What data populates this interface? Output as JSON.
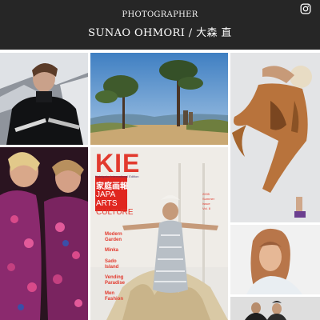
{
  "header": {
    "kicker": "PHOTOGRAPHER",
    "name": "SUNAO OHMORI / 大森 直",
    "background": "#262626"
  },
  "social": {
    "icon": "instagram-icon"
  },
  "gallery": {
    "tiles": [
      {
        "subject": "ski-portrait",
        "accent": "#ffffff"
      },
      {
        "subject": "landscape-pine-trees",
        "accent": "#4a88c4"
      },
      {
        "subject": "dancer-leopard-dress",
        "accent": "#b0743a"
      },
      {
        "subject": "fashion-models-floral-dresses",
        "accent": "#8e2a6c"
      },
      {
        "subject": "magazine-cover-kie",
        "accent": "#e23a2e"
      },
      {
        "subject": "woman-portrait",
        "accent": "#c27a4a"
      },
      {
        "subject": "couple-portrait",
        "accent": "#2a2a2a"
      }
    ],
    "magazine": {
      "logo": "KIE",
      "subtitle": "Kateigaho International Edition",
      "kanji": "家庭画報",
      "headline_lines": [
        "JAPA",
        "ARTS",
        "CULTURE"
      ],
      "issue_lines": [
        "2005",
        "Summer",
        "Issue",
        "Vol. 8"
      ],
      "articles": [
        "Modern",
        "Garden",
        "Minka",
        "Sado",
        "Island",
        "Vending",
        "Paradise",
        "Men",
        "Fashion"
      ]
    }
  }
}
